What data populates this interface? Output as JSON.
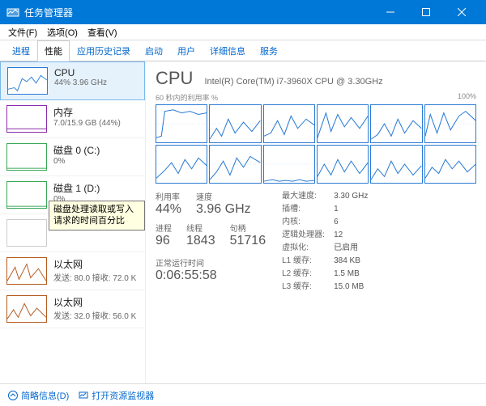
{
  "window": {
    "title": "任务管理器"
  },
  "menu": {
    "file": "文件(F)",
    "options": "选项(O)",
    "view": "查看(V)"
  },
  "tabs": [
    "进程",
    "性能",
    "应用历史记录",
    "启动",
    "用户",
    "详细信息",
    "服务"
  ],
  "active_tab": 1,
  "sidebar": [
    {
      "name": "CPU",
      "sub": "44% 3.96 GHz",
      "color": "#2a7bd4"
    },
    {
      "name": "内存",
      "sub": "7.0/15.9 GB (44%)",
      "color": "#8a2ca8"
    },
    {
      "name": "磁盘 0 (C:)",
      "sub": "0%",
      "color": "#3aa757"
    },
    {
      "name": "磁盘 1 (D:)",
      "sub": "0%",
      "color": "#3aa757"
    },
    {
      "name": "",
      "sub": "",
      "color": "#e0e0e0"
    },
    {
      "name": "以太网",
      "sub": "发送: 80.0 接收: 72.0 K",
      "color": "#b35a1e"
    },
    {
      "name": "以太网",
      "sub": "发送: 32.0 接收: 56.0 K",
      "color": "#b35a1e"
    }
  ],
  "tooltip": "磁盘处理读取或写入请求的时间百分比",
  "cpu": {
    "title": "CPU",
    "model": "Intel(R) Core(TM) i7-3960X CPU @ 3.30GHz",
    "chart_label_left": "60 秒内的利用率 %",
    "chart_label_right": "100%",
    "stats_left": {
      "util_label": "利用率",
      "util_value": "44%",
      "speed_label": "速度",
      "speed_value": "3.96 GHz",
      "proc_label": "进程",
      "proc_value": "96",
      "thread_label": "线程",
      "thread_value": "1843",
      "handle_label": "句柄",
      "handle_value": "51716",
      "uptime_label": "正常运行时间",
      "uptime_value": "0:06:55:58"
    },
    "stats_right": [
      {
        "k": "最大速度:",
        "v": "3.30 GHz"
      },
      {
        "k": "插槽:",
        "v": "1"
      },
      {
        "k": "内核:",
        "v": "6"
      },
      {
        "k": "逻辑处理器:",
        "v": "12"
      },
      {
        "k": "虚拟化:",
        "v": "已启用"
      },
      {
        "k": "L1 缓存:",
        "v": "384 KB"
      },
      {
        "k": "L2 缓存:",
        "v": "1.5 MB"
      },
      {
        "k": "L3 缓存:",
        "v": "15.0 MB"
      }
    ]
  },
  "footer": {
    "less": "简略信息(D)",
    "monitor": "打开资源监视器"
  },
  "chart_data": {
    "type": "line",
    "title": "CPU 利用率 %",
    "ylim": [
      0,
      100
    ],
    "xrange_seconds": 60,
    "series_count": 12,
    "note": "12 logical-processor mini-charts; values fluctuate roughly 20-80% with spikes"
  }
}
